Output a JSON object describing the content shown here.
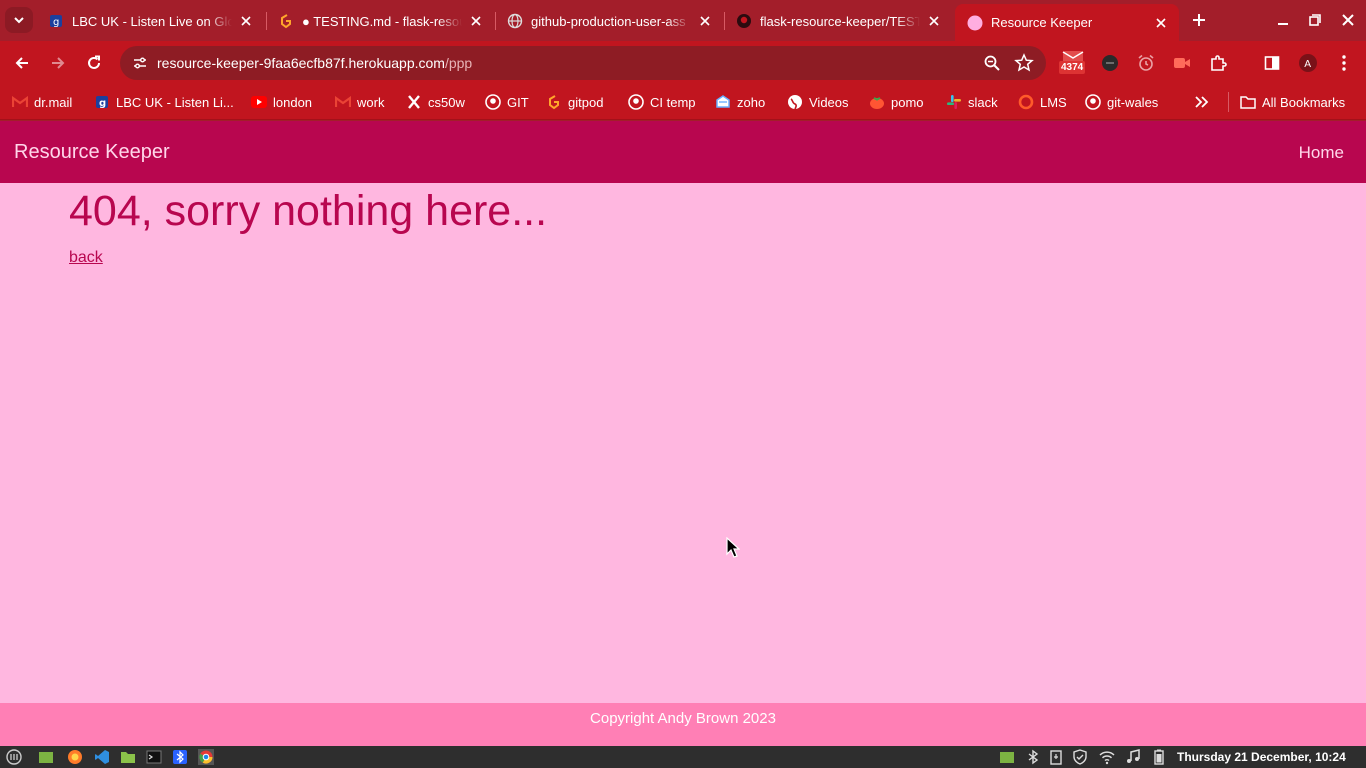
{
  "browser": {
    "tabs": [
      {
        "title": "LBC UK - Listen Live on Glo",
        "icon": "globalplayer-icon"
      },
      {
        "title": "● TESTING.md - flask-resou",
        "icon": "gitpod-icon"
      },
      {
        "title": "github-production-user-ass",
        "icon": "globe-icon"
      },
      {
        "title": "flask-resource-keeper/TEST",
        "icon": "github-icon"
      },
      {
        "title": "Resource Keeper",
        "icon": "page-favicon",
        "active": true
      }
    ],
    "address": {
      "domain": "resource-keeper-9faa6ecfb87f.herokuapp.com",
      "path": "/ppp"
    },
    "extension_badge": "4374",
    "bookmarks": [
      {
        "label": "dr.mail",
        "icon": "gmail-icon"
      },
      {
        "label": "LBC UK - Listen Li...",
        "icon": "globalplayer-icon"
      },
      {
        "label": "london",
        "icon": "youtube-icon"
      },
      {
        "label": "work",
        "icon": "gmail-icon"
      },
      {
        "label": "cs50w",
        "icon": "x-icon"
      },
      {
        "label": "GIT",
        "icon": "github-icon"
      },
      {
        "label": "gitpod",
        "icon": "gitpod-icon"
      },
      {
        "label": "CI temp",
        "icon": "github-icon"
      },
      {
        "label": "zoho",
        "icon": "zoho-icon"
      },
      {
        "label": "Videos",
        "icon": "globe-icon"
      },
      {
        "label": "pomo",
        "icon": "tomato-icon"
      },
      {
        "label": "slack",
        "icon": "slack-icon"
      },
      {
        "label": "LMS",
        "icon": "lms-icon"
      },
      {
        "label": "git-wales",
        "icon": "github-icon"
      }
    ],
    "all_bookmarks_label": "All Bookmarks"
  },
  "site": {
    "brand": "Resource Keeper",
    "nav_home": "Home",
    "heading": "404, sorry nothing here...",
    "back_link": "back",
    "footer": "Copyright Andy Brown 2023"
  },
  "taskbar": {
    "clock": "Thursday 21 December, 10:24"
  },
  "colors": {
    "browser_frame": "#a31e2a",
    "toolbar": "#c1151f",
    "navbar": "#b8064f",
    "page_bg": "#ffb7e0",
    "footer_bg": "#ff7fb5"
  }
}
